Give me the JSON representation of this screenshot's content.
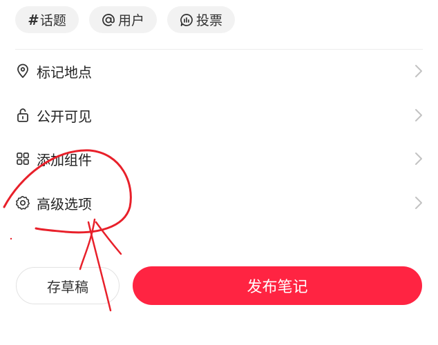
{
  "chips": [
    {
      "label": "话题",
      "icon": "hash-icon"
    },
    {
      "label": "用户",
      "icon": "at-icon"
    },
    {
      "label": "投票",
      "icon": "poll-icon"
    }
  ],
  "options": [
    {
      "label": "标记地点",
      "icon": "location-pin-icon"
    },
    {
      "label": "公开可见",
      "icon": "unlocked-icon"
    },
    {
      "label": "添加组件",
      "icon": "grid-icon"
    },
    {
      "label": "高级选项",
      "icon": "gear-icon"
    }
  ],
  "actions": {
    "draft_label": "存草稿",
    "publish_label": "发布笔记"
  },
  "colors": {
    "accent": "#ff2442",
    "annotation": "#e8202a",
    "chip_bg": "#f2f2f2"
  }
}
